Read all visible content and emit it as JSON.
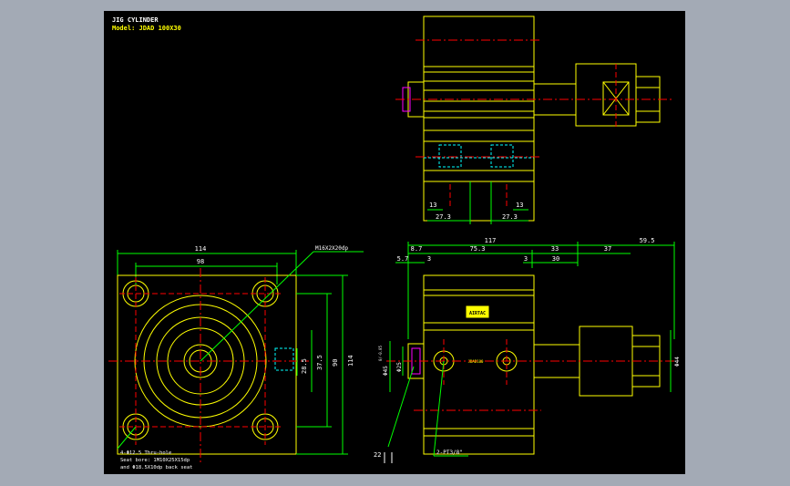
{
  "title_block": {
    "line1": "JIG CYLINDER",
    "line2": "Model: JDAD 100X30"
  },
  "front_view": {
    "dim_overall_width": "114",
    "dim_bolt_pitch": "98",
    "callout_thread": "M16X2X20dp",
    "dim_port_depth": "28.5",
    "dim_h1": "37.5",
    "dim_h2": "90",
    "dim_h3": "114",
    "note_line1": "4-Φ12.5 Thru-hole",
    "note_line2": "Seat bore: 1M10X25X15dp",
    "note_line3": "and Φ18.5X10dp back seat"
  },
  "side_view": {
    "dim_overall": "117",
    "dim_rod": "59.5",
    "dim_a": "8.7",
    "dim_b": "75.3",
    "dim_c": "33",
    "dim_d": "37",
    "dim_e": "5.7",
    "dim_f": "3",
    "dim_g": "3",
    "dim_h": "30",
    "dim_bore_small": "Φ25",
    "dim_bore_rod": "Φ45",
    "dim_tol": "0/-0.05",
    "dim_head": "Φ44",
    "dim_bottom_left": "22",
    "port_note": "2-PT3/8\"",
    "brand_logo": "AIRTAC",
    "small_label": "JDAD100"
  },
  "top_view": {
    "dim_l13": "13",
    "dim_r13": "13",
    "dim_l273": "27.3",
    "dim_r273": "27.3"
  },
  "colors": {
    "background": "#000000",
    "frame": "#a3aab5",
    "outline": "#ffff00",
    "dimension": "#00ff00",
    "centerline": "#ff0000",
    "hidden": "#00ffff",
    "text": "#ffffff",
    "magenta": "#ff00ff"
  }
}
